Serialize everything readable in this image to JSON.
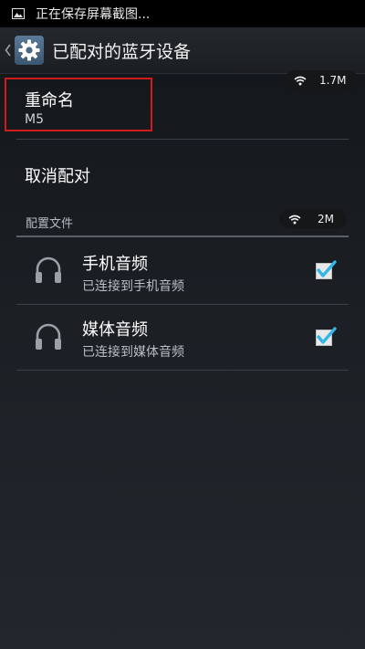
{
  "statusbar": {
    "icon": "image-icon",
    "text": "正在保存屏幕截图..."
  },
  "actionbar": {
    "back_icon": "chevron-left-icon",
    "settings_icon": "gear-icon",
    "title": "已配对的蓝牙设备"
  },
  "network_badges": [
    {
      "icon": "wifi-icon",
      "speed": "1.7M"
    },
    {
      "icon": "wifi-icon",
      "speed": "2M"
    }
  ],
  "rename": {
    "title": "重命名",
    "value": "M5"
  },
  "unpair": {
    "title": "取消配对"
  },
  "profiles": {
    "header": "配置文件",
    "items": [
      {
        "icon": "headphones-icon",
        "title": "手机音频",
        "subtitle": "已连接到手机音频",
        "checked": true
      },
      {
        "icon": "headphones-icon",
        "title": "媒体音频",
        "subtitle": "已连接到媒体音频",
        "checked": true
      }
    ]
  },
  "colors": {
    "accent_check": "#33b5e5",
    "highlight_border": "#d11a1a"
  }
}
